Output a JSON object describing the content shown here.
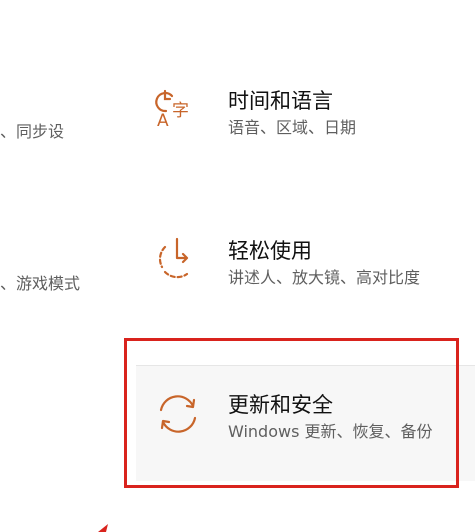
{
  "accent_color": "#c8652a",
  "highlight_color": "#d9231d",
  "left_column": [
    {
      "desc": "、同步设"
    },
    {
      "desc": "、游戏模式"
    }
  ],
  "tiles": [
    {
      "icon": "language-time-icon",
      "title": "时间和语言",
      "desc": "语音、区域、日期"
    },
    {
      "icon": "ease-of-access-icon",
      "title": "轻松使用",
      "desc": "讲述人、放大镜、高对比度"
    },
    {
      "icon": "sync-icon",
      "title": "更新和安全",
      "desc": "Windows 更新、恢复、备份"
    }
  ]
}
